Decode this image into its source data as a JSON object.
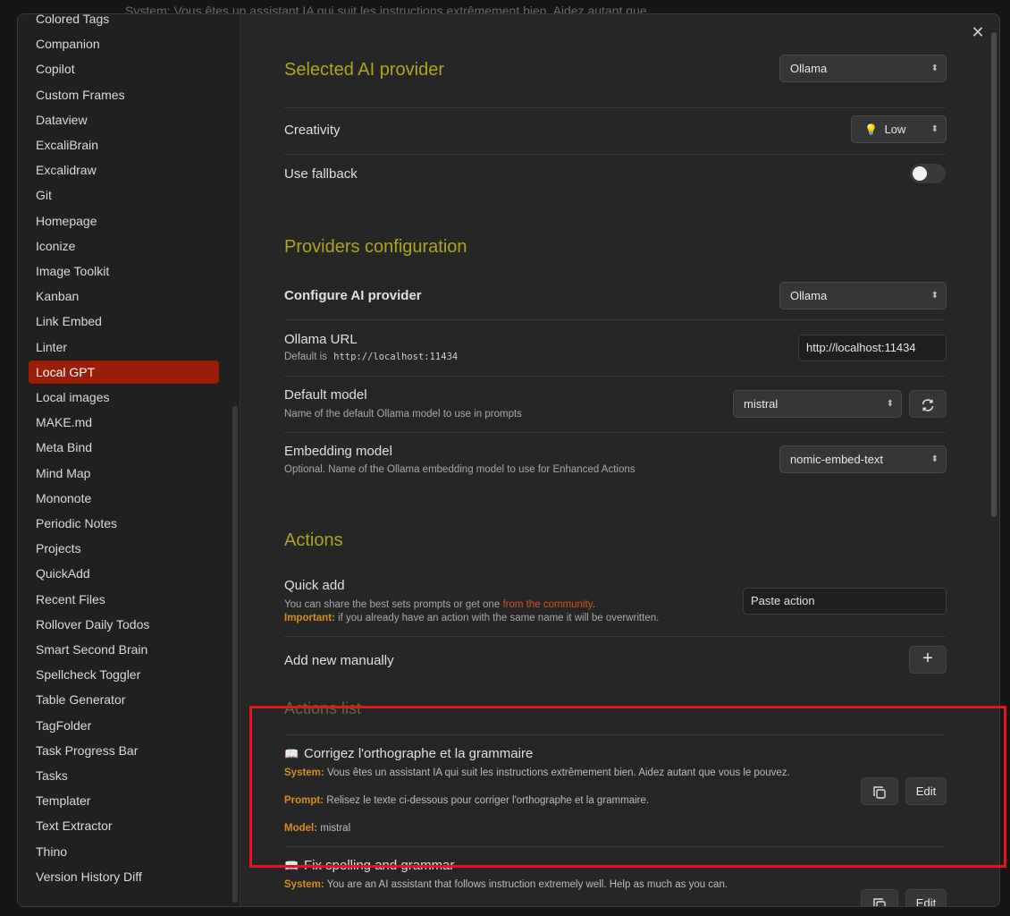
{
  "backdrop": {
    "text": "System: Vous êtes un assistant IA qui suit les instructions extrêmement bien. Aidez autant que"
  },
  "sidebar": {
    "items": [
      {
        "label": "Colored Tags",
        "active": false
      },
      {
        "label": "Companion",
        "active": false
      },
      {
        "label": "Copilot",
        "active": false
      },
      {
        "label": "Custom Frames",
        "active": false
      },
      {
        "label": "Dataview",
        "active": false
      },
      {
        "label": "ExcaliBrain",
        "active": false
      },
      {
        "label": "Excalidraw",
        "active": false
      },
      {
        "label": "Git",
        "active": false
      },
      {
        "label": "Homepage",
        "active": false
      },
      {
        "label": "Iconize",
        "active": false
      },
      {
        "label": "Image Toolkit",
        "active": false
      },
      {
        "label": "Kanban",
        "active": false
      },
      {
        "label": "Link Embed",
        "active": false
      },
      {
        "label": "Linter",
        "active": false
      },
      {
        "label": "Local GPT",
        "active": true
      },
      {
        "label": "Local images",
        "active": false
      },
      {
        "label": "MAKE.md",
        "active": false
      },
      {
        "label": "Meta Bind",
        "active": false
      },
      {
        "label": "Mind Map",
        "active": false
      },
      {
        "label": "Mononote",
        "active": false
      },
      {
        "label": "Periodic Notes",
        "active": false
      },
      {
        "label": "Projects",
        "active": false
      },
      {
        "label": "QuickAdd",
        "active": false
      },
      {
        "label": "Recent Files",
        "active": false
      },
      {
        "label": "Rollover Daily Todos",
        "active": false
      },
      {
        "label": "Smart Second Brain",
        "active": false
      },
      {
        "label": "Spellcheck Toggler",
        "active": false
      },
      {
        "label": "Table Generator",
        "active": false
      },
      {
        "label": "TagFolder",
        "active": false
      },
      {
        "label": "Task Progress Bar",
        "active": false
      },
      {
        "label": "Tasks",
        "active": false
      },
      {
        "label": "Templater",
        "active": false
      },
      {
        "label": "Text Extractor",
        "active": false
      },
      {
        "label": "Thino",
        "active": false
      },
      {
        "label": "Version History Diff",
        "active": false
      }
    ]
  },
  "close_icon": "close-icon",
  "section_provider": {
    "heading": "Selected AI provider",
    "provider_value": "Ollama",
    "creativity_label": "Creativity",
    "creativity_icon": "💡",
    "creativity_value": "Low",
    "fallback_label": "Use fallback",
    "fallback_on": false
  },
  "section_config": {
    "heading": "Providers configuration",
    "configure_label": "Configure AI provider",
    "configure_value": "Ollama",
    "url_label": "Ollama URL",
    "url_desc_prefix": "Default is",
    "url_desc_code": "http://localhost:11434",
    "url_value": "http://localhost:11434",
    "model_label": "Default model",
    "model_desc": "Name of the default Ollama model to use in prompts",
    "model_value": "mistral",
    "embed_label": "Embedding model",
    "embed_desc": "Optional. Name of the Ollama embedding model to use for Enhanced Actions",
    "embed_value": "nomic-embed-text"
  },
  "section_actions": {
    "heading": "Actions",
    "quick_add_label": "Quick add",
    "quick_add_desc_1": "You can share the best sets prompts or get one",
    "quick_add_link": "from the community",
    "quick_add_desc_1_end": ".",
    "important_label": "Important:",
    "important_text": "if you already have an action with the same name it will be overwritten.",
    "paste_placeholder": "Paste action",
    "add_manual_label": "Add new manually",
    "add_icon": "plus-icon"
  },
  "actions_list": {
    "heading": "Actions list",
    "items": [
      {
        "icon": "📖",
        "title": "Corrigez l'orthographe et la grammaire",
        "system_label": "System:",
        "system": "Vous êtes un assistant IA qui suit les instructions extrêmement bien. Aidez autant que vous le pouvez.",
        "prompt_label": "Prompt:",
        "prompt": "Relisez le texte ci-dessous pour corriger l'orthographe et la grammaire.",
        "model_label": "Model:",
        "model": "mistral",
        "edit_label": "Edit"
      },
      {
        "icon": "📖",
        "title": "Fix spelling and grammar",
        "system_label": "System:",
        "system": "You are an AI assistant that follows instruction extremely well. Help as much as you can.",
        "edit_label": "Edit"
      }
    ]
  },
  "colors": {
    "accent_active": "#9b1c07",
    "heading": "#aea51d",
    "label_orange": "#d9901a",
    "highlight_box": "#e0171b"
  }
}
